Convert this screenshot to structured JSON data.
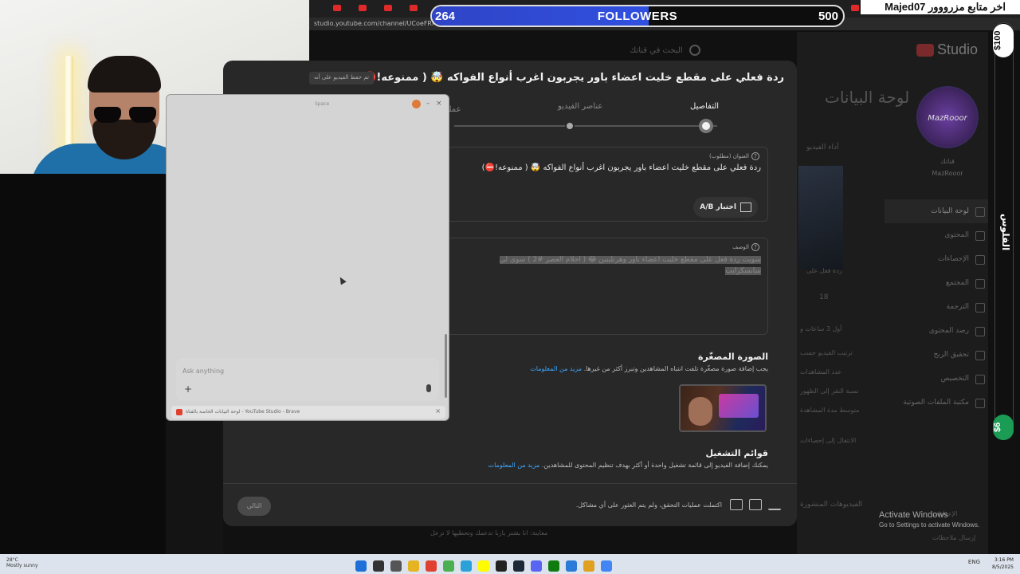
{
  "overlay": {
    "followers_current": "264",
    "followers_label": "FOLLOWERS",
    "followers_goal": "500",
    "followers_progress": 0.528,
    "last_follower": "اخر متابع مزرووور Majed07",
    "money_top": "$100",
    "money_bottom": "$6",
    "vertical_label": "الفلوس"
  },
  "browser": {
    "url": "studio.youtube.com/channel/UCoeFRM6koXzGkx..."
  },
  "studio": {
    "logo": "Studio",
    "search_placeholder": "البحث في قناتك",
    "big_title": "لوحة البيانات",
    "avatar_text": "MazRooor",
    "channel_label": "قناتك",
    "channel_name": "MazRooor",
    "section_perf": "أداء الفيديو",
    "sidebar": [
      {
        "label": "لوحة البيانات",
        "active": true
      },
      {
        "label": "المحتوى",
        "active": false
      },
      {
        "label": "الإحصاءات",
        "active": false
      },
      {
        "label": "المجتمع",
        "active": false
      },
      {
        "label": "الترجمة",
        "active": false
      },
      {
        "label": "رصد المحتوى",
        "active": false
      },
      {
        "label": "تحقيق الربح",
        "active": false
      },
      {
        "label": "التخصيص",
        "active": false
      },
      {
        "label": "مكتبة الملفات الصوتية",
        "active": false
      }
    ],
    "bottom_items": [
      "الإعدادات",
      "إرسال ملاحظات"
    ],
    "muted_rows": [
      "ردة فعل على",
      "أول 3 ساعات و",
      "ترتيب الفيديو حسب",
      "عدد المشاهدات",
      "نسبة النقر إلى الظهور",
      "متوسط مدة المشاهدة",
      "الانتقال إلى إحصاءات",
      "الفيديوهات المنشورة",
      "معاينة: انا بشتر ياربا تدعمك وتحطيها لا تزعل"
    ],
    "likes_count": "18"
  },
  "activate": {
    "title": "Activate Windows",
    "subtitle": "Go to Settings to activate Windows."
  },
  "modal": {
    "title": "ردة فعلي على مقطع خليت اعضاء باور يجربون اغرب أنواع الفواكه 🤯 ( ممنوعه!⛔)",
    "save_chip": "تم حفظ الفيديو على أنه",
    "steps": [
      {
        "label": "التفاصيل",
        "active": true
      },
      {
        "label": "عناصر الفيديو",
        "active": false
      },
      {
        "label": "عمليات",
        "active": false
      }
    ],
    "title_field": {
      "label": "العنوان (مطلوب)",
      "value": "ردة فعلي على مقطع خليت اعضاء باور يجربون اغرب أنواع الفواكه 🤯 ( ممنوعه!⛔)"
    },
    "ab_button": "اختبار A/B",
    "description_field": {
      "label": "الوصف",
      "value": "سويت ردة فعل على مقطع خليت اعضاء باور وهرتليبين 😂 ( احلام العصر #2 ) سوي لي سابسكرايب"
    },
    "thumbnail": {
      "title": "الصورة المصغّرة",
      "text": "يجب إضافة صورة مصغّرة تلفت انتباه المشاهدين وتبرز أكثر من غيرها.",
      "link": "مزيد من المعلومات"
    },
    "playlists": {
      "title": "قوائم التشغيل",
      "text": "يمكنك إضافة الفيديو إلى قائمة تشغيل واحدة أو أكثر بهدف تنظيم المحتوى للمشاهدين.",
      "link": "مزيد من المعلومات"
    },
    "footer": {
      "status": "اكتملت عمليات التحقق، ولم يتم العثور على أي مشاكل.",
      "next_button": "التالي",
      "icons": [
        "subtitles-icon",
        "hd-icon",
        "upload-icon"
      ]
    }
  },
  "assistant": {
    "space_label": "Space",
    "ask_placeholder": "Ask anything",
    "footer_text": "لوحة البيانات الخاصة بالقناة - YouTube Studio - Brave"
  },
  "taskbar": {
    "weather_temp": "28°C",
    "weather_desc": "Mostly sunny",
    "time": "3:16 PM",
    "date": "8/5/2025",
    "lang": "ENG",
    "icons": [
      "windows-icon",
      "search-icon",
      "taskview-icon",
      "file-explorer-icon",
      "brave-icon",
      "minecraft-icon",
      "telegram-icon",
      "snapchat-icon",
      "obs-icon",
      "steam-icon",
      "discord-icon",
      "xbox-icon",
      "photos-icon",
      "chrome-icon",
      "chrome-icon"
    ],
    "icon_colors": [
      "#1e6fd8",
      "#333333",
      "#555555",
      "#e6b422",
      "#e04030",
      "#4caf50",
      "#2aa1d9",
      "#fffc00",
      "#222222",
      "#1b2838",
      "#5865f2",
      "#107c10",
      "#2a7ad8",
      "#e0a020",
      "#4285f4"
    ]
  }
}
